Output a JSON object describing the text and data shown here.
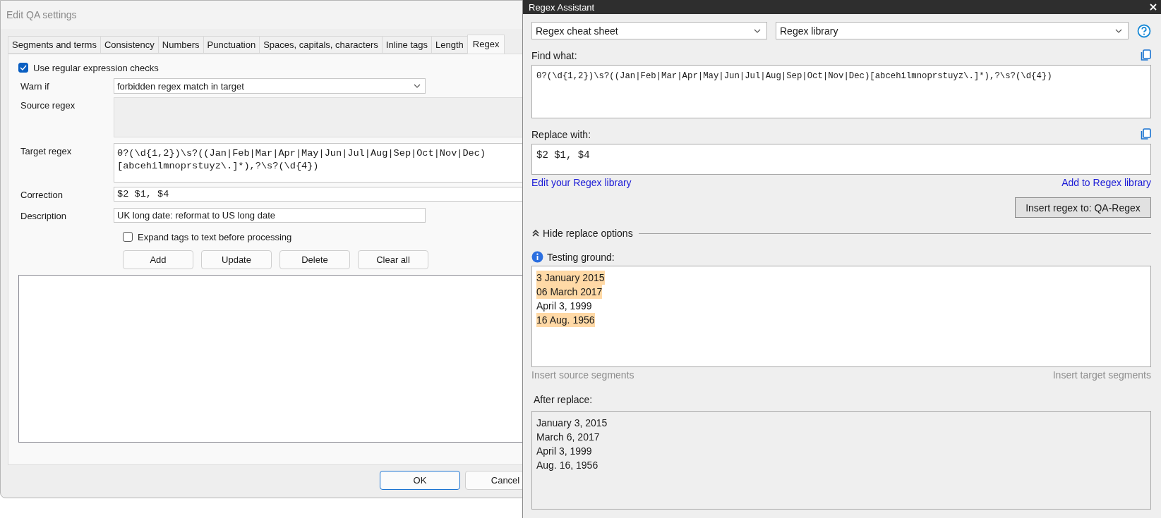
{
  "qa_dialog": {
    "title": "Edit QA settings",
    "tabs": [
      {
        "label": "Segments and terms",
        "selected": false
      },
      {
        "label": "Consistency",
        "selected": false
      },
      {
        "label": "Numbers",
        "selected": false
      },
      {
        "label": "Punctuation",
        "selected": false
      },
      {
        "label": "Spaces, capitals, characters",
        "selected": false
      },
      {
        "label": "Inline tags",
        "selected": false
      },
      {
        "label": "Length",
        "selected": false
      },
      {
        "label": "Regex",
        "selected": true
      }
    ],
    "use_regex": {
      "label": "Use regular expression checks",
      "checked": true
    },
    "warn_if": {
      "label": "Warn if",
      "value": "forbidden regex match in target"
    },
    "source_regex": {
      "label": "Source regex",
      "disabled": true
    },
    "target_regex": {
      "label": "Target regex",
      "value": "0?(\\d{1,2})\\s?((Jan|Feb|Mar|Apr|May|Jun|Jul|Aug|Sep|Oct|Nov|Dec)[abcehilmnoprstuyz\\.]*),?\\s?(\\d{4})"
    },
    "correction": {
      "label": "Correction",
      "value": "$2 $1, $4"
    },
    "description": {
      "label": "Description",
      "value": "UK long date: reformat to US long date"
    },
    "expand_tags": {
      "label": "Expand tags to text before processing",
      "checked": false
    },
    "buttons": [
      "Add",
      "Update",
      "Delete",
      "Clear all"
    ],
    "footer_buttons": [
      {
        "label": "OK",
        "default": true
      },
      {
        "label": "Cancel",
        "default": false
      }
    ]
  },
  "regex_assistant": {
    "title": "Regex Assistant",
    "cheat_sheet": {
      "value": "Regex cheat sheet"
    },
    "library": {
      "value": "Regex library"
    },
    "find_what": {
      "label": "Find what:",
      "value": "0?(\\d{1,2})\\s?((Jan|Feb|Mar|Apr|May|Jun|Jul|Aug|Sep|Oct|Nov|Dec)[abcehilmnoprstuyz\\.]*),?\\s?(\\d{4})"
    },
    "replace_with": {
      "label": "Replace with:",
      "value": "$2 $1, $4"
    },
    "edit_library_link": "Edit your Regex library",
    "add_library_link": "Add to Regex library",
    "insert_button": "Insert regex to: QA-Regex",
    "replace_options": {
      "label": "Hide replace options",
      "expanded": true
    },
    "testing_ground": {
      "label": "Testing ground:",
      "lines": [
        {
          "text": "3 January 2015",
          "matched": true
        },
        {
          "text": "06 March 2017",
          "matched": true
        },
        {
          "text": "April 3, 1999",
          "matched": false
        },
        {
          "text": "16 Aug. 1956",
          "matched": true
        }
      ]
    },
    "insert_source": {
      "label": "Insert source segments",
      "disabled": true
    },
    "insert_target": {
      "label": "Insert target segments",
      "disabled": true
    },
    "after_replace": {
      "label": "After replace:",
      "lines": [
        "January 3, 2015",
        "March 6, 2017",
        "April 3, 1999",
        "Aug. 16, 1956"
      ]
    }
  }
}
